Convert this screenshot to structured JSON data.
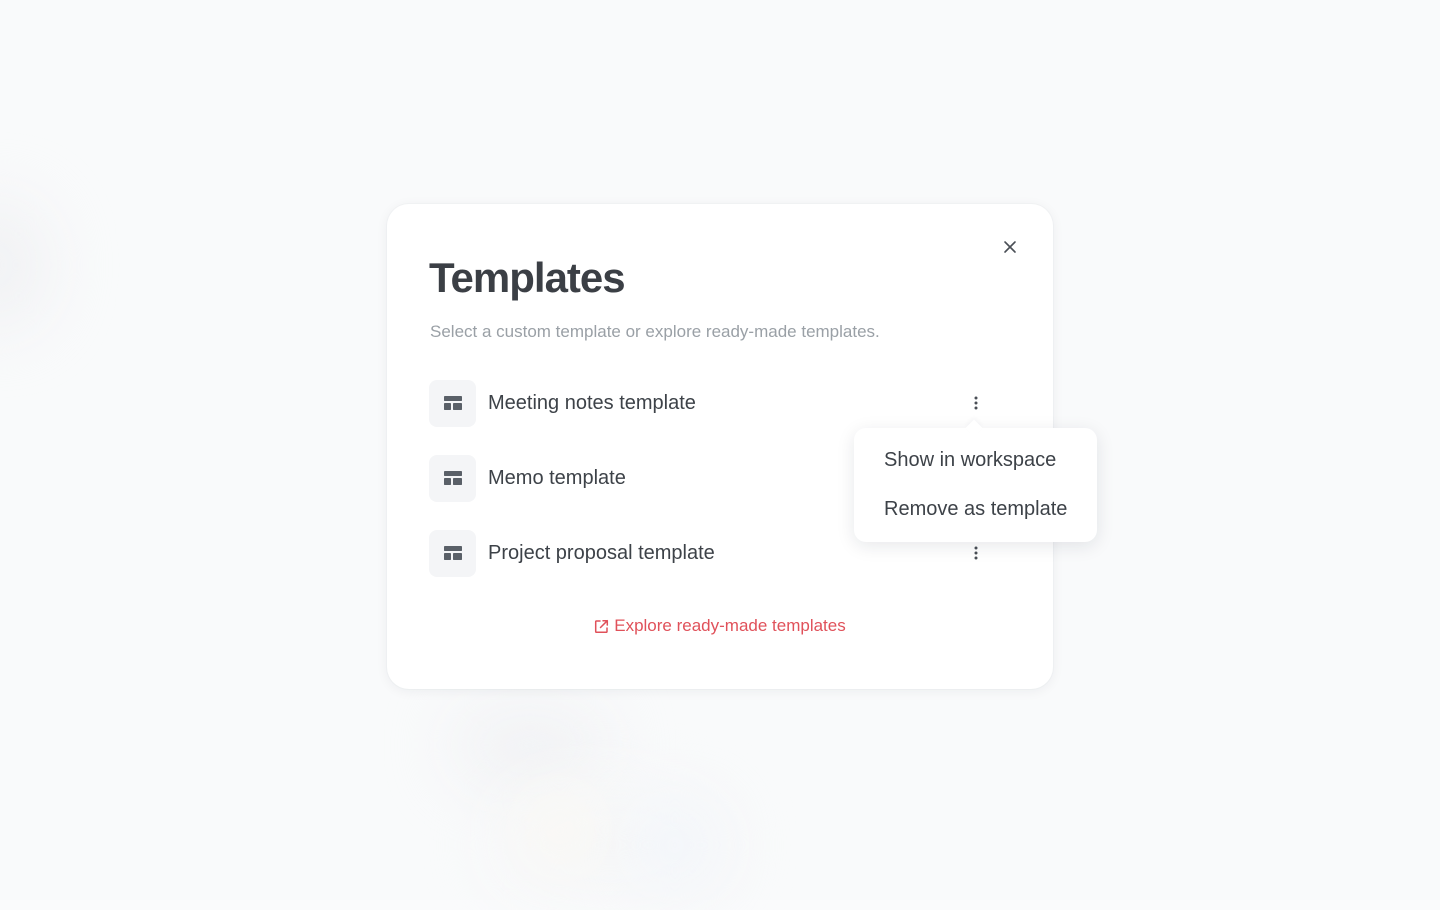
{
  "modal": {
    "title": "Templates",
    "subtitle": "Select a custom template or explore ready-made templates.",
    "templates": [
      {
        "name": "Meeting notes template"
      },
      {
        "name": "Memo template"
      },
      {
        "name": "Project proposal template"
      }
    ],
    "explore_link": "Explore ready-made templates"
  },
  "dropdown": {
    "items": [
      {
        "label": "Show in workspace"
      },
      {
        "label": "Remove as template"
      }
    ]
  },
  "icons": {
    "close": "close-icon",
    "template": "template-layout-icon",
    "more": "more-vertical-icon",
    "external": "external-link-icon"
  },
  "colors": {
    "accent": "#e0515a",
    "title": "#3b3f45",
    "subtitle": "#9aa0a6",
    "icon_box": "#f4f5f7"
  }
}
